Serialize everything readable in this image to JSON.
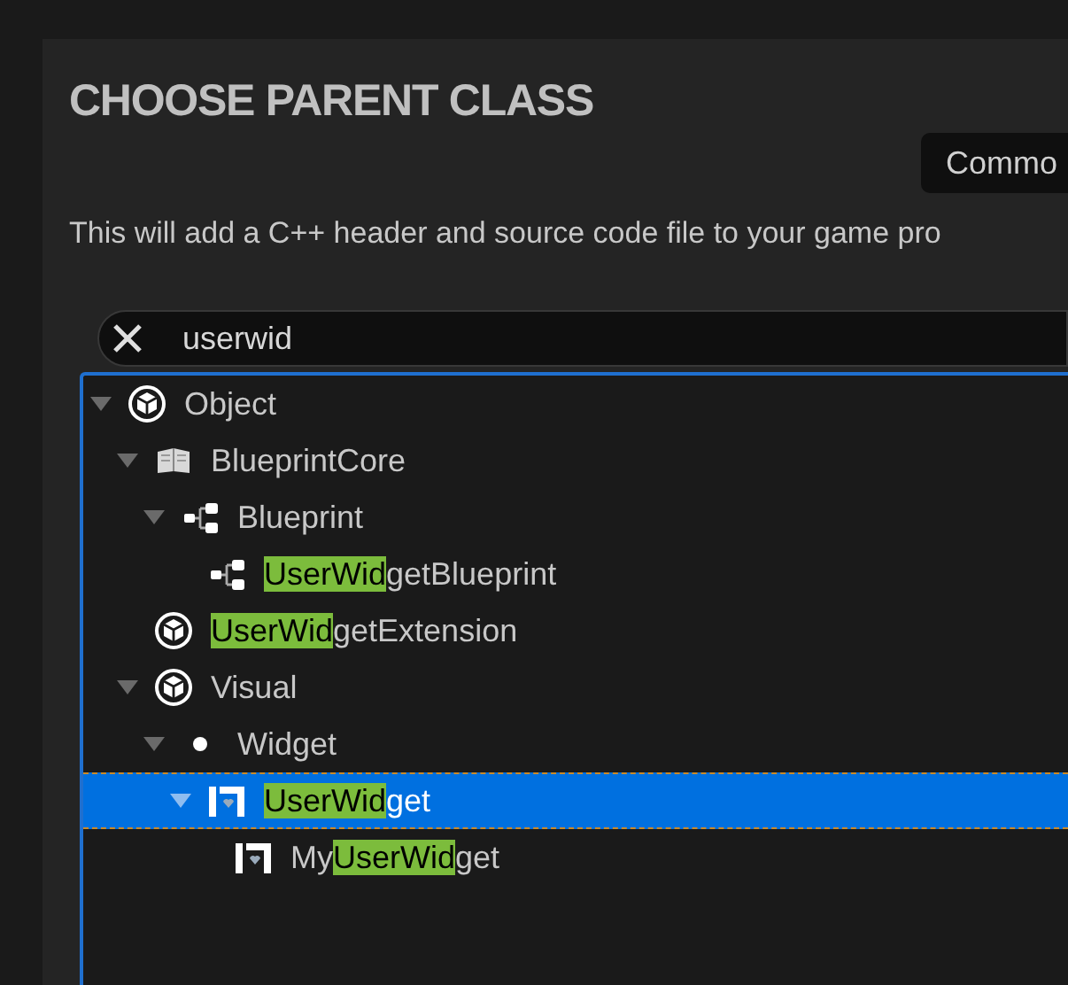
{
  "dialog": {
    "title": "CHOOSE PARENT CLASS",
    "common_button": "Commo",
    "description": "This will add a C++ header and source code file to your game pro"
  },
  "search": {
    "value": "userwid"
  },
  "tree": [
    {
      "kind": "cube",
      "before": "Object",
      "selected": false,
      "expanded": true,
      "children": [
        {
          "kind": "book",
          "before": "BlueprintCore",
          "selected": false,
          "expanded": true,
          "children": [
            {
              "kind": "graph",
              "before": "Blueprint",
              "selected": false,
              "expanded": true,
              "children": [
                {
                  "kind": "graph",
                  "match": "UserWid",
                  "after": "getBlueprint",
                  "selected": false
                }
              ]
            }
          ]
        },
        {
          "kind": "cube",
          "match": "UserWid",
          "after": "getExtension",
          "selected": false
        },
        {
          "kind": "cube",
          "before": "Visual",
          "selected": false,
          "expanded": true,
          "children": [
            {
              "kind": "dot",
              "before": "Widget",
              "selected": false,
              "expanded": true,
              "children": [
                {
                  "kind": "widget",
                  "match": "UserWid",
                  "after": "get",
                  "selected": true,
                  "expanded": true,
                  "children": [
                    {
                      "kind": "widget",
                      "before": "My",
                      "match": "UserWid",
                      "after": "get",
                      "selected": false
                    }
                  ]
                }
              ]
            }
          ]
        }
      ]
    }
  ]
}
